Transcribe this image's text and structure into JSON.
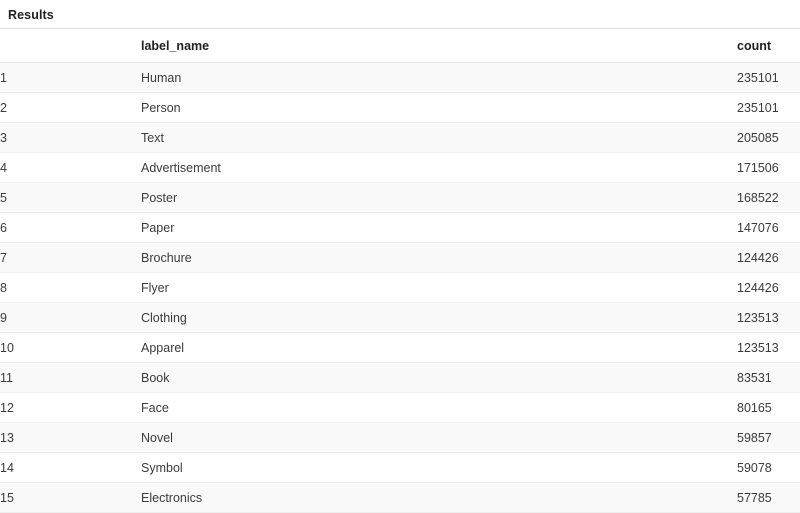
{
  "panel": {
    "title": "Results"
  },
  "table": {
    "columns": [
      {
        "key": "index",
        "label": "",
        "align": "left"
      },
      {
        "key": "label_name",
        "label": "label_name",
        "align": "left"
      },
      {
        "key": "count",
        "label": "count",
        "align": "left"
      }
    ],
    "rows": [
      {
        "index": "1",
        "label_name": "Human",
        "count": "235101"
      },
      {
        "index": "2",
        "label_name": "Person",
        "count": "235101"
      },
      {
        "index": "3",
        "label_name": "Text",
        "count": "205085"
      },
      {
        "index": "4",
        "label_name": "Advertisement",
        "count": "171506"
      },
      {
        "index": "5",
        "label_name": "Poster",
        "count": "168522"
      },
      {
        "index": "6",
        "label_name": "Paper",
        "count": "147076"
      },
      {
        "index": "7",
        "label_name": "Brochure",
        "count": "124426"
      },
      {
        "index": "8",
        "label_name": "Flyer",
        "count": "124426"
      },
      {
        "index": "9",
        "label_name": "Clothing",
        "count": "123513"
      },
      {
        "index": "10",
        "label_name": "Apparel",
        "count": "123513"
      },
      {
        "index": "11",
        "label_name": "Book",
        "count": "83531"
      },
      {
        "index": "12",
        "label_name": "Face",
        "count": "80165"
      },
      {
        "index": "13",
        "label_name": "Novel",
        "count": "59857"
      },
      {
        "index": "14",
        "label_name": "Symbol",
        "count": "59078"
      },
      {
        "index": "15",
        "label_name": "Electronics",
        "count": "57785"
      }
    ]
  },
  "colors": {
    "background": "#ffffff",
    "stripe": "#f9f9f9",
    "border": "#eeeeee",
    "divider": "#e3e3e3",
    "text": "#3b3b3b",
    "heading": "#222222"
  }
}
